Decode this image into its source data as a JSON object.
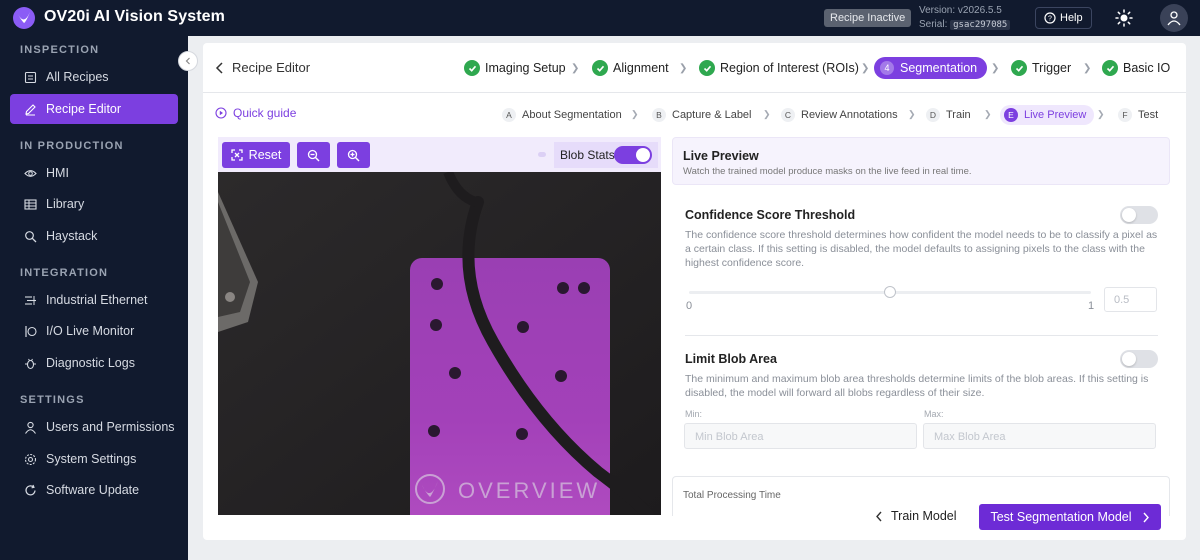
{
  "app": {
    "title": "OV20i AI Vision System",
    "status_badge": "Recipe Inactive",
    "version": "Version: v2026.5.5",
    "serial_label": "Serial:",
    "serial_value": "gsac297085",
    "help_label": "Help"
  },
  "sidebar": {
    "sections": [
      {
        "title": "INSPECTION",
        "items": [
          {
            "label": "All Recipes",
            "icon": "list-icon"
          },
          {
            "label": "Recipe Editor",
            "icon": "edit-icon",
            "active": true
          }
        ]
      },
      {
        "title": "IN PRODUCTION",
        "items": [
          {
            "label": "HMI",
            "icon": "eye-icon"
          },
          {
            "label": "Library",
            "icon": "table-icon"
          },
          {
            "label": "Haystack",
            "icon": "search-icon"
          }
        ]
      },
      {
        "title": "INTEGRATION",
        "items": [
          {
            "label": "Industrial Ethernet",
            "icon": "network-icon"
          },
          {
            "label": "I/O Live Monitor",
            "icon": "io-monitor-icon"
          },
          {
            "label": "Diagnostic Logs",
            "icon": "bug-icon"
          }
        ]
      },
      {
        "title": "SETTINGS",
        "items": [
          {
            "label": "Users and Permissions",
            "icon": "user-icon"
          },
          {
            "label": "System Settings",
            "icon": "gear-icon"
          },
          {
            "label": "Software Update",
            "icon": "refresh-icon"
          }
        ]
      }
    ]
  },
  "header": {
    "back_label": "Recipe Editor",
    "steps": [
      {
        "label": "Imaging Setup",
        "status": "complete"
      },
      {
        "label": "Alignment",
        "status": "complete"
      },
      {
        "label": "Region of Interest (ROIs)",
        "status": "complete"
      },
      {
        "label": "Segmentation",
        "status": "active",
        "number": "4"
      },
      {
        "label": "Trigger",
        "status": "complete"
      },
      {
        "label": "Basic IO",
        "status": "complete"
      }
    ]
  },
  "substeps": {
    "guide_label": "Quick guide",
    "items": [
      {
        "letter": "A",
        "label": "About Segmentation"
      },
      {
        "letter": "B",
        "label": "Capture & Label"
      },
      {
        "letter": "C",
        "label": "Review Annotations"
      },
      {
        "letter": "D",
        "label": "Train"
      },
      {
        "letter": "E",
        "label": "Live Preview",
        "active": true
      },
      {
        "letter": "F",
        "label": "Test"
      }
    ]
  },
  "image_panel": {
    "reset_label": "Reset",
    "blob_stats_label": "Blob Stats",
    "blob_stats_on": true,
    "part_watermark": "OVERVIEW"
  },
  "live_preview": {
    "title": "Live Preview",
    "subtitle": "Watch the trained model produce masks on the live feed in real time.",
    "confidence": {
      "title": "Confidence Score Threshold",
      "description": "The confidence score threshold determines how confident the model needs to be to classify a pixel as a certain class. If this setting is disabled, the model defaults to assigning pixels to the class with the highest confidence score.",
      "enabled": false,
      "min_label": "0",
      "max_label": "1",
      "value": "0.5",
      "slider_value": 0.5
    },
    "blob_area": {
      "title": "Limit Blob Area",
      "description": "The minimum and maximum blob area thresholds determine limits of the blob areas. If this setting is disabled, the model will forward all blobs regardless of their size.",
      "enabled": false,
      "min_label": "Min:",
      "min_placeholder": "Min Blob Area",
      "max_label": "Max:",
      "max_placeholder": "Max Blob Area"
    },
    "processing_time_label": "Total Processing Time"
  },
  "footer": {
    "train_label": "Train Model",
    "test_label": "Test Segmentation Model"
  },
  "colors": {
    "accent": "#7c3fe0",
    "sidebar_bg": "#111a2e",
    "success": "#2fa84f"
  }
}
